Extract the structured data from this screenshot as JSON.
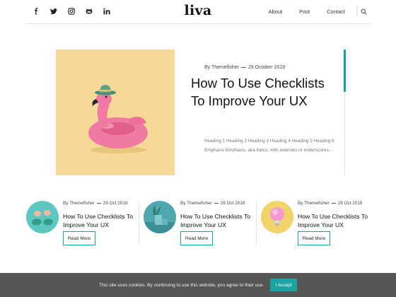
{
  "header": {
    "logo": "liva",
    "social_icons": [
      "facebook-icon",
      "twitter-icon",
      "instagram-icon",
      "github-icon",
      "linkedin-icon"
    ],
    "nav": [
      "About",
      "Post",
      "Contact"
    ],
    "search_icon": "search-icon"
  },
  "featured": {
    "author": "By Themefisher",
    "date": "29 October 2019",
    "title": "How To Use Checklists To Improve Your UX",
    "excerpt": "Heading 1 Heading 2 Heading 3 Heading 4 Heading 5 Heading 6 Emphasis Emphasis, aka italics, with asterisks or underscores..."
  },
  "cards": [
    {
      "author": "By Themefisher",
      "date": "29 Oct 2019",
      "title": "How To Use Checklists To Improve Your UX",
      "button": "Read More"
    },
    {
      "author": "By Themefisher",
      "date": "29 Oct 2019",
      "title": "How To Use Checklists To Improve Your UX",
      "button": "Read More"
    },
    {
      "author": "By Themefisher",
      "date": "29 Oct 2019",
      "title": "How To Use Checklists To Improve Your UX",
      "button": "Read More"
    }
  ],
  "cookie": {
    "message": "This site uses cookies. By continuing to use this website, you agree to their use.",
    "accept": "I Accept"
  },
  "colors": {
    "accent": "#1aa3a3",
    "featured_bg": "#f6d997",
    "cookie_bg": "#565656"
  }
}
